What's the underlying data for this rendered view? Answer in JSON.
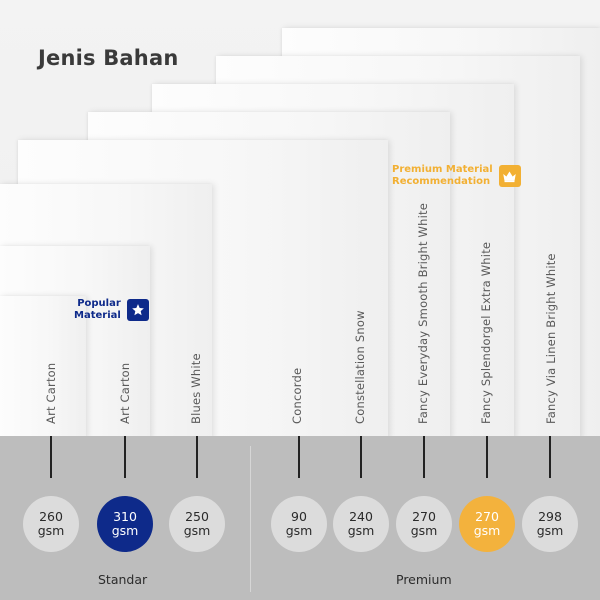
{
  "title": "Jenis Bahan",
  "badges": {
    "popular": {
      "line1": "Popular",
      "line2": "Material",
      "icon": "star-icon",
      "color": "#0e2a8a"
    },
    "premium": {
      "line1": "Premium Material",
      "line2": "Recommendation",
      "icon": "crown-icon",
      "color": "#f2b033"
    }
  },
  "materials": [
    {
      "name": "Art Carton",
      "weight": "260",
      "unit": "gsm",
      "group": "Standar",
      "highlight": "none"
    },
    {
      "name": "Art Carton",
      "weight": "310",
      "unit": "gsm",
      "group": "Standar",
      "highlight": "blue"
    },
    {
      "name": "Blues White",
      "weight": "250",
      "unit": "gsm",
      "group": "Standar",
      "highlight": "none"
    },
    {
      "name": "Concorde",
      "weight": "90",
      "unit": "gsm",
      "group": "Premium",
      "highlight": "none"
    },
    {
      "name": "Constellation Snow",
      "weight": "240",
      "unit": "gsm",
      "group": "Premium",
      "highlight": "none"
    },
    {
      "name": "Fancy Everyday Smooth Bright White",
      "weight": "270",
      "unit": "gsm",
      "group": "Premium",
      "highlight": "none"
    },
    {
      "name": "Fancy Splendorgel Extra White",
      "weight": "270",
      "unit": "gsm",
      "group": "Premium",
      "highlight": "orange"
    },
    {
      "name": "Fancy Via Linen Bright White",
      "weight": "298",
      "unit": "gsm",
      "group": "Premium",
      "highlight": "none"
    }
  ],
  "groups": {
    "standar": "Standar",
    "premium": "Premium"
  },
  "colors": {
    "band": "#bdbdbd",
    "circle": "#dcdcdc",
    "blue": "#0e2a8a",
    "orange": "#f3b23d"
  }
}
